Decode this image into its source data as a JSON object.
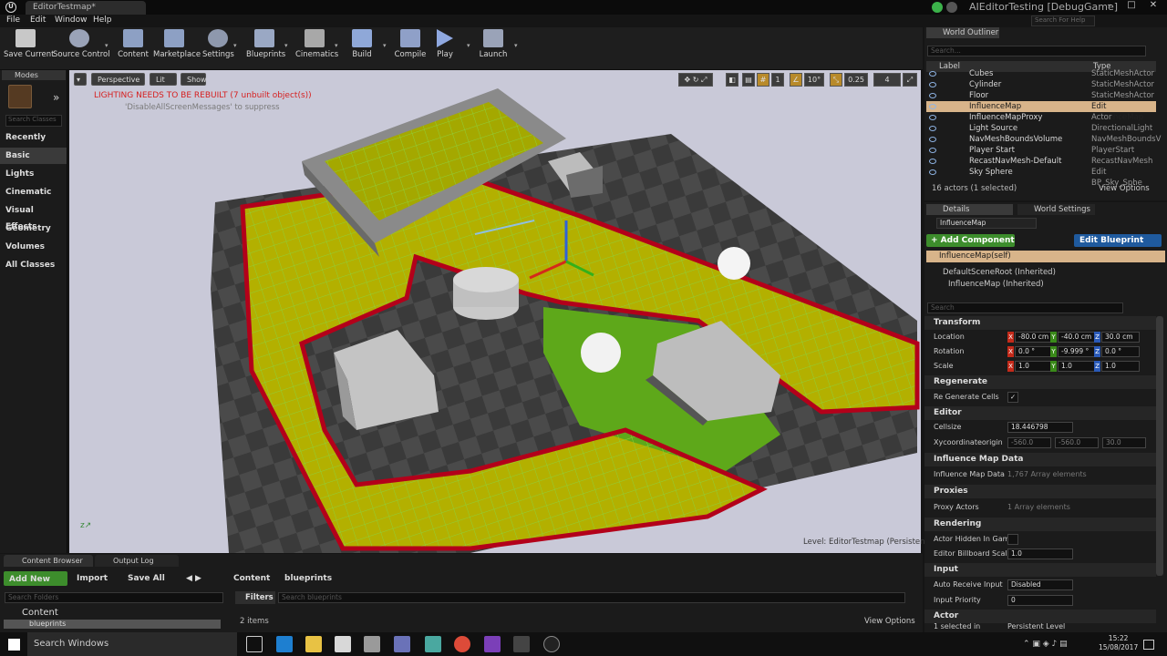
{
  "app": {
    "doc_tab": "EditorTestmap*",
    "project": "AIEditorTesting [DebugGame]",
    "help_search": "Search For Help"
  },
  "menu": [
    "File",
    "Edit",
    "Window",
    "Help"
  ],
  "toolbar": [
    "Save Current",
    "Source Control",
    "Content",
    "Marketplace",
    "Settings",
    "Blueprints",
    "Cinematics",
    "Build",
    "Compile",
    "Play",
    "Launch"
  ],
  "modes": {
    "tab": "Modes",
    "search_placeholder": "Search Classes",
    "items": [
      "Recently Placed",
      "Basic",
      "Lights",
      "Cinematic",
      "Visual Effects",
      "Geometry",
      "Volumes",
      "All Classes"
    ]
  },
  "viewport": {
    "perspective": "Perspective",
    "lit": "Lit",
    "show": "Show",
    "warning": "LIGHTING NEEDS TO BE REBUILT (7 unbuilt object(s))",
    "suppress": "'DisableAllScreenMessages' to suppress",
    "level": "Level:  EditorTestmap (Persistent)",
    "grid": "1",
    "angle": "10°",
    "scale": "0.25",
    "cam": "4"
  },
  "outliner": {
    "title": "World Outliner",
    "search": "Search...",
    "col_label": "Label",
    "col_type": "Type",
    "rows": [
      {
        "name": "Cubes",
        "type": "StaticMeshActor"
      },
      {
        "name": "Cylinder",
        "type": "StaticMeshActor"
      },
      {
        "name": "Floor",
        "type": "StaticMeshActor"
      },
      {
        "name": "InfluenceMap",
        "type": "Edit InfluenceMap"
      },
      {
        "name": "InfluenceMapProxy",
        "type": "Actor"
      },
      {
        "name": "Light Source",
        "type": "DirectionalLight"
      },
      {
        "name": "NavMeshBoundsVolume",
        "type": "NavMeshBoundsV"
      },
      {
        "name": "Player Start",
        "type": "PlayerStart"
      },
      {
        "name": "RecastNavMesh-Default",
        "type": "RecastNavMesh"
      },
      {
        "name": "Sky Sphere",
        "type": "Edit BP_Sky_Sphe"
      }
    ],
    "count": "16 actors (1 selected)",
    "view_options": "View Options"
  },
  "details": {
    "tab": "Details",
    "tab2": "World Settings",
    "name": "InfluenceMap",
    "add_component": "+ Add Component",
    "edit_blueprint": "Edit Blueprint",
    "self": "InfluenceMap(self)",
    "root": "DefaultSceneRoot (Inherited)",
    "child": "InfluenceMap (Inherited)",
    "search": "Search",
    "transform": "Transform",
    "location_label": "Location",
    "loc": [
      "-80.0 cm",
      "-40.0 cm",
      "30.0 cm"
    ],
    "rotation_label": "Rotation",
    "rot": [
      "0.0 °",
      "-9.999 °",
      "0.0 °"
    ],
    "scale_label": "Scale",
    "scale": [
      "1.0",
      "1.0",
      "1.0"
    ],
    "regenerate": "Regenerate",
    "regen_cells": "Re Generate Cells",
    "editor": "Editor",
    "cellsize_label": "Cellsize",
    "cellsize": "18.446798",
    "xyc_label": "Xycoordinateorigin",
    "xyc": [
      "-560.0",
      "-560.0",
      "30.0"
    ],
    "imd": "Influence Map Data",
    "imd_row": "Influence Map Data",
    "imd_val": "1,767 Array elements",
    "proxies": "Proxies",
    "proxy_label": "Proxy Actors",
    "proxy_val": "1 Array elements",
    "rendering": "Rendering",
    "hidden_label": "Actor Hidden In Game",
    "billboard_label": "Editor Billboard Scale",
    "billboard_val": "1.0",
    "input": "Input",
    "auto_label": "Auto Receive Input",
    "auto_val": "Disabled",
    "priority_label": "Input Priority",
    "priority_val": "0",
    "actor": "Actor",
    "selected_label": "1 selected in",
    "selected_val": "Persistent Level"
  },
  "bottom": {
    "tab1": "Content Browser",
    "tab2": "Output Log",
    "add_new": "Add New",
    "import": "Import",
    "save_all": "Save All",
    "crumb1": "Content",
    "crumb2": "blueprints",
    "search_folders": "Search Folders",
    "folder1": "Content",
    "folder2": "blueprints",
    "filters": "Filters",
    "search_bp": "Search blueprints",
    "items": "2 items",
    "view_options": "View Options"
  },
  "taskbar": {
    "search": "Search Windows",
    "time": "15:22",
    "date": "15/08/2017"
  },
  "colors": {
    "accent": "#d8b48a",
    "warning": "#d62020",
    "green": "#3d8d2c",
    "blue": "#1f5a9e"
  }
}
